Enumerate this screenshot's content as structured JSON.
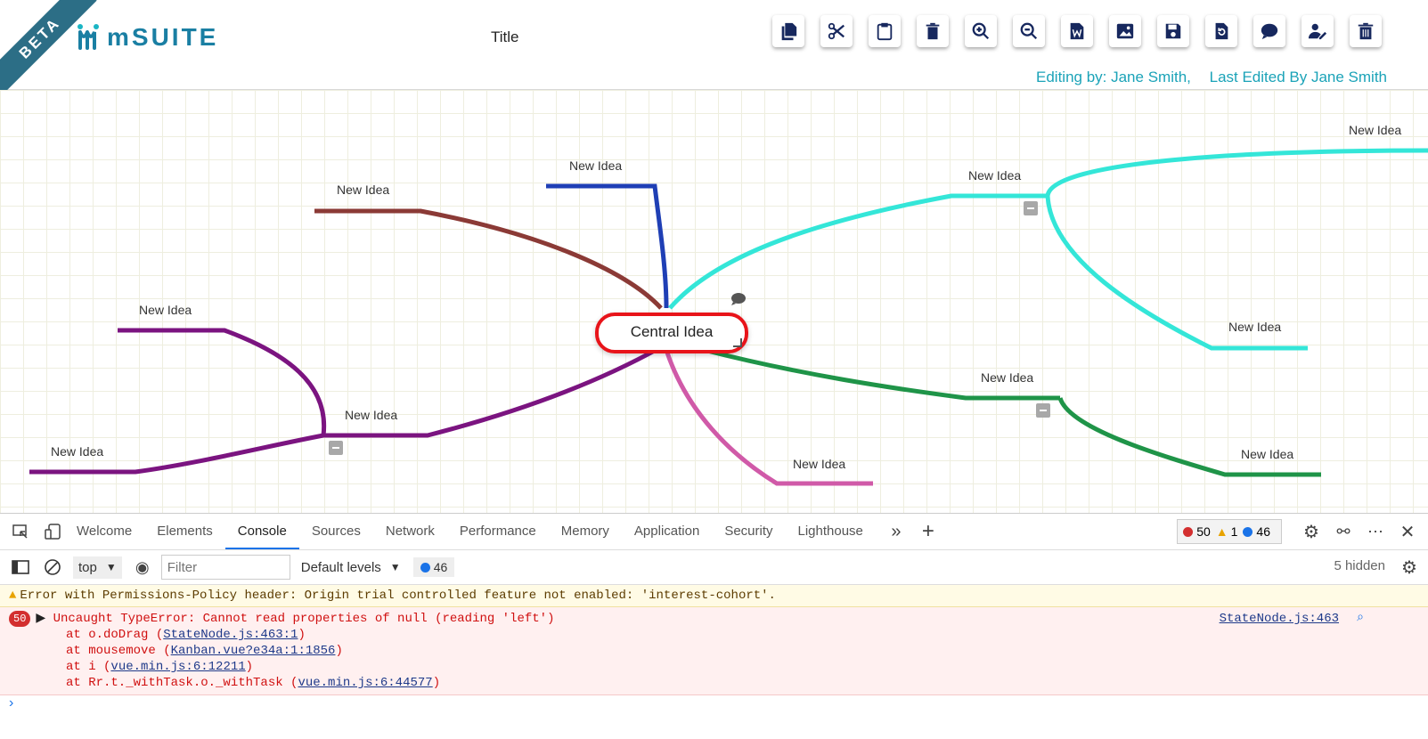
{
  "header": {
    "beta": "BETA",
    "logo_text": "mSUITE",
    "title": "Title",
    "editing_by": "Editing by: Jane Smith,",
    "last_edited": "Last Edited By Jane Smith"
  },
  "toolbar": [
    "copy-icon",
    "cut-icon",
    "paste-icon",
    "delete-icon",
    "zoom-in-icon",
    "zoom-out-icon",
    "word-export-icon",
    "image-icon",
    "save-icon",
    "restore-icon",
    "comment-icon",
    "edit-user-icon",
    "trash-icon"
  ],
  "mindmap": {
    "central": "Central Idea",
    "nodes": [
      {
        "label": "New Idea",
        "color": "#1f3fb5"
      },
      {
        "label": "New Idea",
        "color": "#8b3a36"
      },
      {
        "label": "New Idea",
        "color": "#34e6d8"
      },
      {
        "label": "New Idea",
        "color": "#34e6d8"
      },
      {
        "label": "New Idea",
        "color": "#34e6d8"
      },
      {
        "label": "New Idea",
        "color": "#1f9448"
      },
      {
        "label": "New Idea",
        "color": "#1f9448"
      },
      {
        "label": "New Idea",
        "color": "#d05aa8"
      },
      {
        "label": "New Idea",
        "color": "#7b1480"
      },
      {
        "label": "New Idea",
        "color": "#7b1480"
      },
      {
        "label": "New Idea",
        "color": "#7b1480"
      }
    ]
  },
  "devtools": {
    "tabs": [
      "Welcome",
      "Elements",
      "Console",
      "Sources",
      "Network",
      "Performance",
      "Memory",
      "Application",
      "Security",
      "Lighthouse"
    ],
    "active_tab": "Console",
    "errors": "50",
    "warnings": "1",
    "messages": "46",
    "context": "top",
    "filter_placeholder": "Filter",
    "levels": "Default levels",
    "msg_count": "46",
    "hidden": "5 hidden",
    "warning_text": "Error with Permissions-Policy header: Origin trial controlled feature not enabled: 'interest-cohort'.",
    "error_count": "50",
    "error_text": "Uncaught TypeError: Cannot read properties of null (reading 'left')",
    "error_source": "StateNode.js:463",
    "trace": [
      {
        "pre": "at o.doDrag (",
        "link": "StateNode.js:463:1",
        "post": ")"
      },
      {
        "pre": "at mousemove (",
        "link": "Kanban.vue?e34a:1:1856",
        "post": ")"
      },
      {
        "pre": "at i (",
        "link": "vue.min.js:6:12211",
        "post": ")"
      },
      {
        "pre": "at Rr.t._withTask.o._withTask (",
        "link": "vue.min.js:6:44577",
        "post": ")"
      }
    ]
  }
}
